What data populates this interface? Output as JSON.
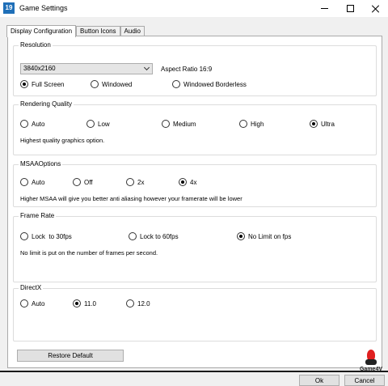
{
  "window": {
    "app_icon": "19",
    "title": "Game Settings"
  },
  "tabs": [
    {
      "label": "Display Configuration",
      "active": true
    },
    {
      "label": "Button Icons",
      "active": false
    },
    {
      "label": "Audio",
      "active": false
    }
  ],
  "resolution": {
    "title": "Resolution",
    "selected": "3840x2160",
    "aspect_ratio": "Aspect Ratio 16:9",
    "modes": {
      "full_screen": "Full Screen",
      "windowed": "Windowed",
      "windowed_borderless": "Windowed Borderless"
    },
    "selected_mode": "Full Screen"
  },
  "rendering_quality": {
    "title": "Rendering Quality",
    "options": {
      "auto": "Auto",
      "low": "Low",
      "medium": "Medium",
      "high": "High",
      "ultra": "Ultra"
    },
    "selected": "Ultra",
    "description": "Highest quality graphics option."
  },
  "msaa": {
    "title": "MSAAOptions",
    "options": {
      "auto": "Auto",
      "off": "Off",
      "x2": "2x",
      "x4": "4x"
    },
    "selected": "4x",
    "description": "Higher MSAA will give you better anti aliasing however your framerate will be lower"
  },
  "frame_rate": {
    "title": "Frame Rate",
    "options": {
      "lock30": "Lock  to 30fps",
      "lock60": "Lock to 60fps",
      "no_limit": "No Limit on fps"
    },
    "selected": "No Limit on fps",
    "description": "No limit is put on the number of frames per second."
  },
  "directx": {
    "title": "DirectX",
    "options": {
      "auto": "Auto",
      "v11": "11.0",
      "v12": "12.0"
    },
    "selected": "11.0"
  },
  "buttons": {
    "restore_default": "Restore Default",
    "ok": "Ok",
    "cancel": "Cancel"
  },
  "watermark": "Game4V"
}
